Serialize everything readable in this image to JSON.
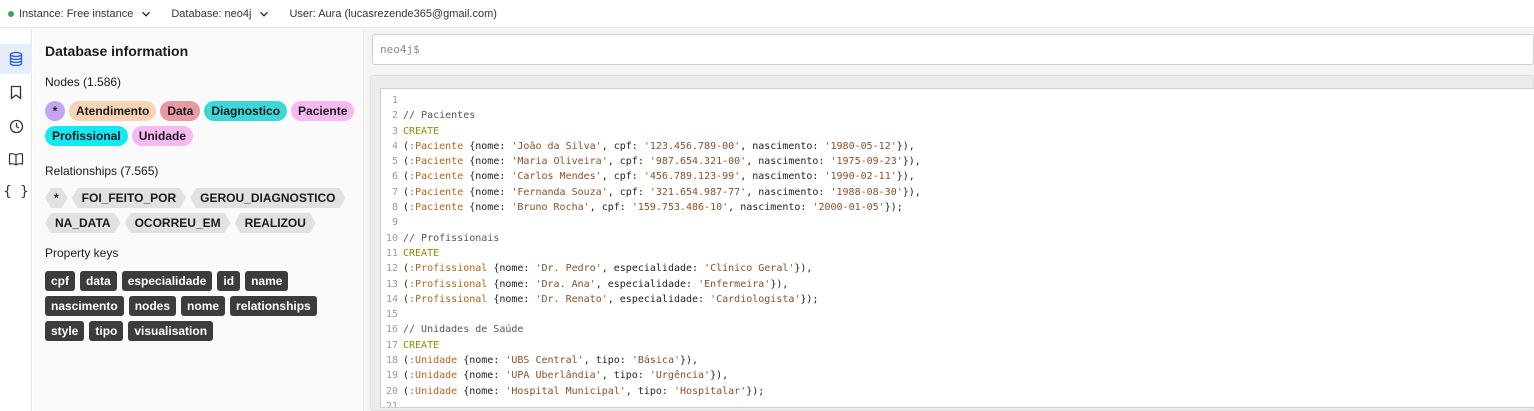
{
  "topbar": {
    "instance": "Instance: Free instance",
    "database": "Database: neo4j",
    "user": "User: Aura (lucasrezende365@gmail.com)"
  },
  "rail": {
    "icons": [
      "database-icon",
      "bookmark-icon",
      "clock-icon",
      "book-icon",
      "braces-icon"
    ],
    "braces_text": "{ }"
  },
  "sidebar": {
    "title": "Database information",
    "nodes_label": "Nodes (1.586)",
    "nodes": [
      {
        "label": "*",
        "color": "#c3a4ee"
      },
      {
        "label": "Atendimento",
        "color": "#f8d3b5"
      },
      {
        "label": "Data",
        "color": "#e79aa4"
      },
      {
        "label": "Diagnostico",
        "color": "#3ed7d7"
      },
      {
        "label": "Paciente",
        "color": "#f7b9f2"
      },
      {
        "label": "Profissional",
        "color": "#16e8f3"
      },
      {
        "label": "Unidade",
        "color": "#f7b9f2"
      }
    ],
    "relationships_label": "Relationships (7.565)",
    "relationships": [
      "*",
      "FOI_FEITO_POR",
      "GEROU_DIAGNOSTICO",
      "NA_DATA",
      "OCORREU_EM",
      "REALIZOU"
    ],
    "property_keys_label": "Property keys",
    "property_keys": [
      "cpf",
      "data",
      "especialidade",
      "id",
      "name",
      "nascimento",
      "nodes",
      "nome",
      "relationships",
      "style",
      "tipo",
      "visualisation"
    ]
  },
  "editor": {
    "prompt": "neo4j$",
    "lines": [
      [],
      [
        [
          "cm",
          "// Pacientes"
        ]
      ],
      [
        [
          "kw",
          "CREATE"
        ]
      ],
      [
        [
          "",
          "("
        ],
        [
          "lbl",
          ":Paciente"
        ],
        [
          "",
          " {nome: "
        ],
        [
          "str",
          "'João da Silva'"
        ],
        [
          "",
          ", cpf: "
        ],
        [
          "str",
          "'123.456.789-00'"
        ],
        [
          "",
          ", nascimento: "
        ],
        [
          "str",
          "'1980-05-12'"
        ],
        [
          "",
          "}),"
        ]
      ],
      [
        [
          "",
          "("
        ],
        [
          "lbl",
          ":Paciente"
        ],
        [
          "",
          " {nome: "
        ],
        [
          "str",
          "'Maria Oliveira'"
        ],
        [
          "",
          ", cpf: "
        ],
        [
          "str",
          "'987.654.321-00'"
        ],
        [
          "",
          ", nascimento: "
        ],
        [
          "str",
          "'1975-09-23'"
        ],
        [
          "",
          "}),"
        ]
      ],
      [
        [
          "",
          "("
        ],
        [
          "lbl",
          ":Paciente"
        ],
        [
          "",
          " {nome: "
        ],
        [
          "str",
          "'Carlos Mendes'"
        ],
        [
          "",
          ", cpf: "
        ],
        [
          "str",
          "'456.789.123-99'"
        ],
        [
          "",
          ", nascimento: "
        ],
        [
          "str",
          "'1990-02-11'"
        ],
        [
          "",
          "}),"
        ]
      ],
      [
        [
          "",
          "("
        ],
        [
          "lbl",
          ":Paciente"
        ],
        [
          "",
          " {nome: "
        ],
        [
          "str",
          "'Fernanda Souza'"
        ],
        [
          "",
          ", cpf: "
        ],
        [
          "str",
          "'321.654.987-77'"
        ],
        [
          "",
          ", nascimento: "
        ],
        [
          "str",
          "'1988-08-30'"
        ],
        [
          "",
          "}),"
        ]
      ],
      [
        [
          "",
          "("
        ],
        [
          "lbl",
          ":Paciente"
        ],
        [
          "",
          " {nome: "
        ],
        [
          "str",
          "'Bruno Rocha'"
        ],
        [
          "",
          ", cpf: "
        ],
        [
          "str",
          "'159.753.486-10'"
        ],
        [
          "",
          ", nascimento: "
        ],
        [
          "str",
          "'2000-01-05'"
        ],
        [
          "",
          "});"
        ]
      ],
      [],
      [
        [
          "cm",
          "// Profissionais"
        ]
      ],
      [
        [
          "kw",
          "CREATE"
        ]
      ],
      [
        [
          "",
          "("
        ],
        [
          "lbl",
          ":Profissional"
        ],
        [
          "",
          " {nome: "
        ],
        [
          "str",
          "'Dr. Pedro'"
        ],
        [
          "",
          ", especialidade: "
        ],
        [
          "str",
          "'Clínico Geral'"
        ],
        [
          "",
          "}),"
        ]
      ],
      [
        [
          "",
          "("
        ],
        [
          "lbl",
          ":Profissional"
        ],
        [
          "",
          " {nome: "
        ],
        [
          "str",
          "'Dra. Ana'"
        ],
        [
          "",
          ", especialidade: "
        ],
        [
          "str",
          "'Enfermeira'"
        ],
        [
          "",
          "}),"
        ]
      ],
      [
        [
          "",
          "("
        ],
        [
          "lbl",
          ":Profissional"
        ],
        [
          "",
          " {nome: "
        ],
        [
          "str",
          "'Dr. Renato'"
        ],
        [
          "",
          ", especialidade: "
        ],
        [
          "str",
          "'Cardiologista'"
        ],
        [
          "",
          "});"
        ]
      ],
      [],
      [
        [
          "cm",
          "// Unidades de Saúde"
        ]
      ],
      [
        [
          "kw",
          "CREATE"
        ]
      ],
      [
        [
          "",
          "("
        ],
        [
          "lbl",
          ":Unidade"
        ],
        [
          "",
          " {nome: "
        ],
        [
          "str",
          "'UBS Central'"
        ],
        [
          "",
          ", tipo: "
        ],
        [
          "str",
          "'Básica'"
        ],
        [
          "",
          "}),"
        ]
      ],
      [
        [
          "",
          "("
        ],
        [
          "lbl",
          ":Unidade"
        ],
        [
          "",
          " {nome: "
        ],
        [
          "str",
          "'UPA Uberlândia'"
        ],
        [
          "",
          ", tipo: "
        ],
        [
          "str",
          "'Urgência'"
        ],
        [
          "",
          "}),"
        ]
      ],
      [
        [
          "",
          "("
        ],
        [
          "lbl",
          ":Unidade"
        ],
        [
          "",
          " {nome: "
        ],
        [
          "str",
          "'Hospital Municipal'"
        ],
        [
          "",
          ", tipo: "
        ],
        [
          "str",
          "'Hospitalar'"
        ],
        [
          "",
          "});"
        ]
      ],
      []
    ]
  }
}
